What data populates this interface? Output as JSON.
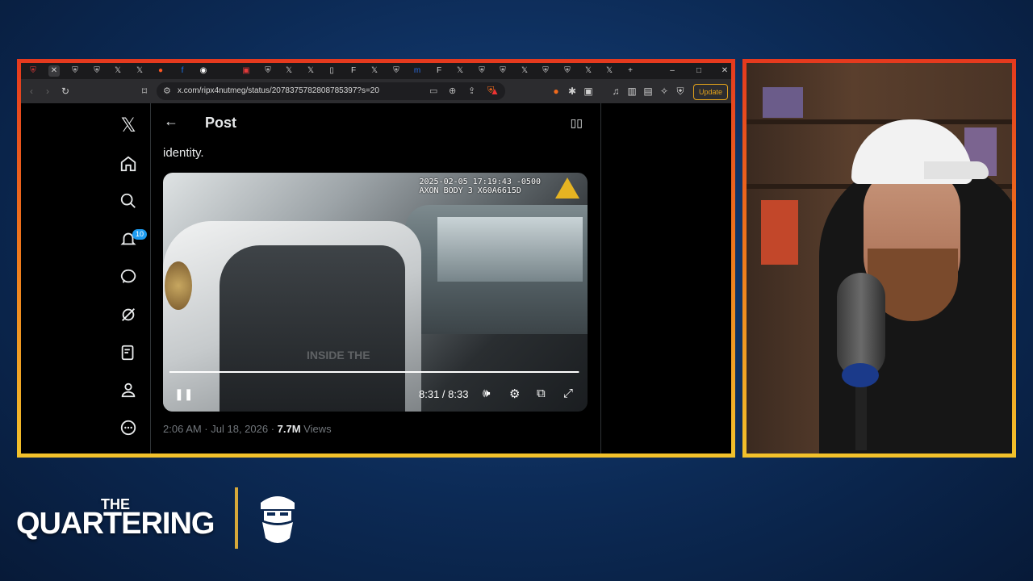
{
  "browser": {
    "url": "x.com/ripx4nutmeg/status/2078375782808785397?s=20",
    "update_label": "Update",
    "tab_icons": [
      "shield-icon",
      "close-icon",
      "shield-icon",
      "shield-icon",
      "x-icon",
      "x-icon",
      "reddit-icon",
      "facebook-icon",
      "chrome-icon",
      "shield-icon",
      "shield-icon",
      "x-icon",
      "x-icon",
      "generic-icon",
      "f-icon",
      "x-icon",
      "m-icon",
      "f-icon",
      "x-icon",
      "shield-icon",
      "x-icon",
      "shield-icon",
      "shield-icon",
      "x-icon",
      "x-icon",
      "plus-icon"
    ],
    "window_controls": [
      "minimize",
      "maximize",
      "close"
    ]
  },
  "x_nav": {
    "notifications_badge": "10",
    "items": [
      "x-logo",
      "home",
      "search",
      "notifications",
      "messages",
      "grok",
      "lists",
      "profile",
      "more"
    ]
  },
  "post": {
    "header_title": "Post",
    "text": "identity.",
    "video": {
      "stamp_line1": "2025-02-05 17:19:43 -0500",
      "stamp_line2": "AXON BODY 3 X60A6615D",
      "watermark": "INSIDE THE",
      "time_display": "8:31 / 8:33",
      "progress_fraction": 0.998
    },
    "meta_time": "2:06 AM · Jul 18, 2026 · ",
    "views_count": "7.7M",
    "views_label": " Views"
  },
  "branding": {
    "the": "THE",
    "name": "QUARTERING",
    "accent_color": "#d6a83a"
  }
}
